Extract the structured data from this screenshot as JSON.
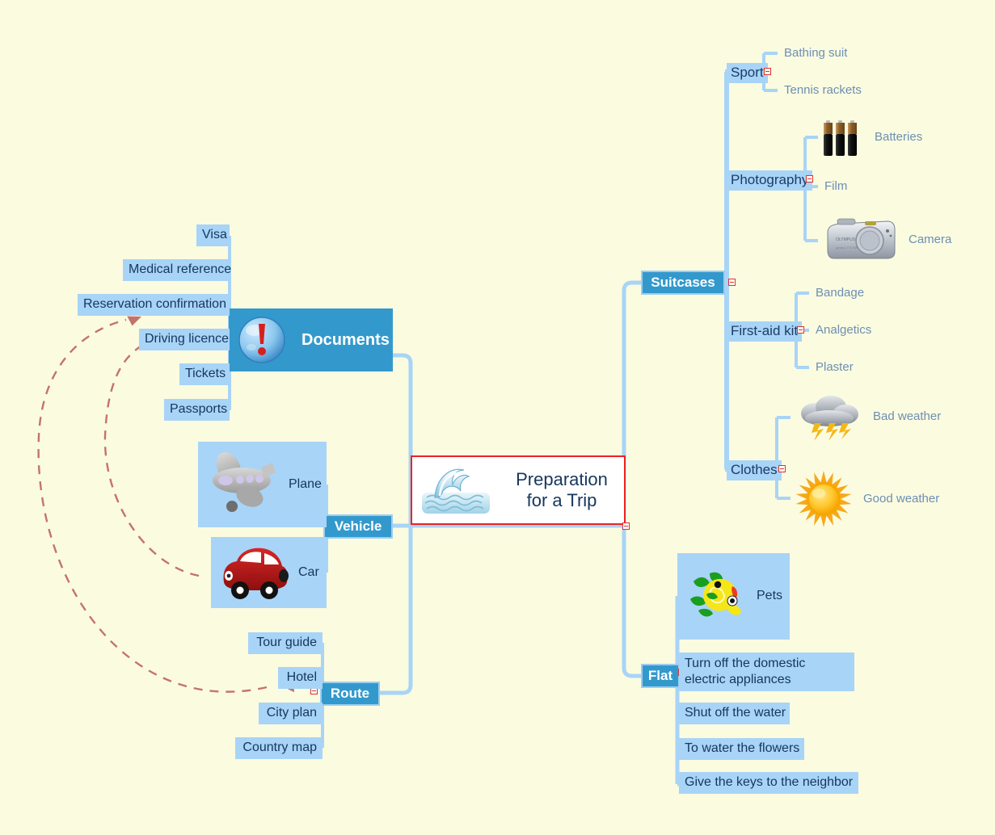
{
  "title": "Preparation for a Trip",
  "colors": {
    "page_background": "#fbfbe0",
    "connector": "#a8d4f7",
    "badge_fill": "#3399cc",
    "badge_border": "#9dcdf0",
    "highlight_fill": "#a8d4f7",
    "leaf_text": "#6c8fb3",
    "dark_text": "#16365c",
    "central_border": "#ee2222",
    "relation_arrow": "#c4736c"
  },
  "central": {
    "line1": "Preparation",
    "line2": "for a Trip",
    "icon": "wave-icon"
  },
  "branches": {
    "documents": {
      "label": "Documents",
      "icon": "exclamation-icon",
      "items": [
        {
          "label": "Visa"
        },
        {
          "label": "Medical reference"
        },
        {
          "label": "Reservation confirmation"
        },
        {
          "label": "Driving licence"
        },
        {
          "label": "Tickets"
        },
        {
          "label": "Passports"
        }
      ]
    },
    "vehicle": {
      "label": "Vehicle",
      "items": [
        {
          "label": "Plane",
          "icon": "plane-icon"
        },
        {
          "label": "Car",
          "icon": "car-icon"
        }
      ]
    },
    "route": {
      "label": "Route",
      "items": [
        {
          "label": "Tour guide"
        },
        {
          "label": "Hotel"
        },
        {
          "label": "City plan"
        },
        {
          "label": "Country map"
        }
      ]
    },
    "suitcases": {
      "label": "Suitcases",
      "groups": [
        {
          "label": "Sport",
          "items": [
            {
              "label": "Bathing suit"
            },
            {
              "label": "Tennis rackets"
            }
          ]
        },
        {
          "label": "Photography",
          "items": [
            {
              "label": "Batteries",
              "icon": "batteries-icon"
            },
            {
              "label": "Film"
            },
            {
              "label": "Camera",
              "icon": "camera-icon"
            }
          ]
        },
        {
          "label": "First-aid kit",
          "items": [
            {
              "label": "Bandage"
            },
            {
              "label": "Analgetics"
            },
            {
              "label": "Plaster"
            }
          ]
        },
        {
          "label": "Clothes",
          "items": [
            {
              "label": "Bad weather",
              "icon": "storm-icon"
            },
            {
              "label": "Good weather",
              "icon": "sun-icon"
            }
          ]
        }
      ]
    },
    "flat": {
      "label": "Flat",
      "items": [
        {
          "label": "Pets",
          "icon": "fish-icon"
        },
        {
          "label": "Turn off the domestic electric appliances"
        },
        {
          "label": "Shut off the water"
        },
        {
          "label": "To water the flowers"
        },
        {
          "label": "Give the keys to  the neighbor"
        }
      ]
    }
  }
}
